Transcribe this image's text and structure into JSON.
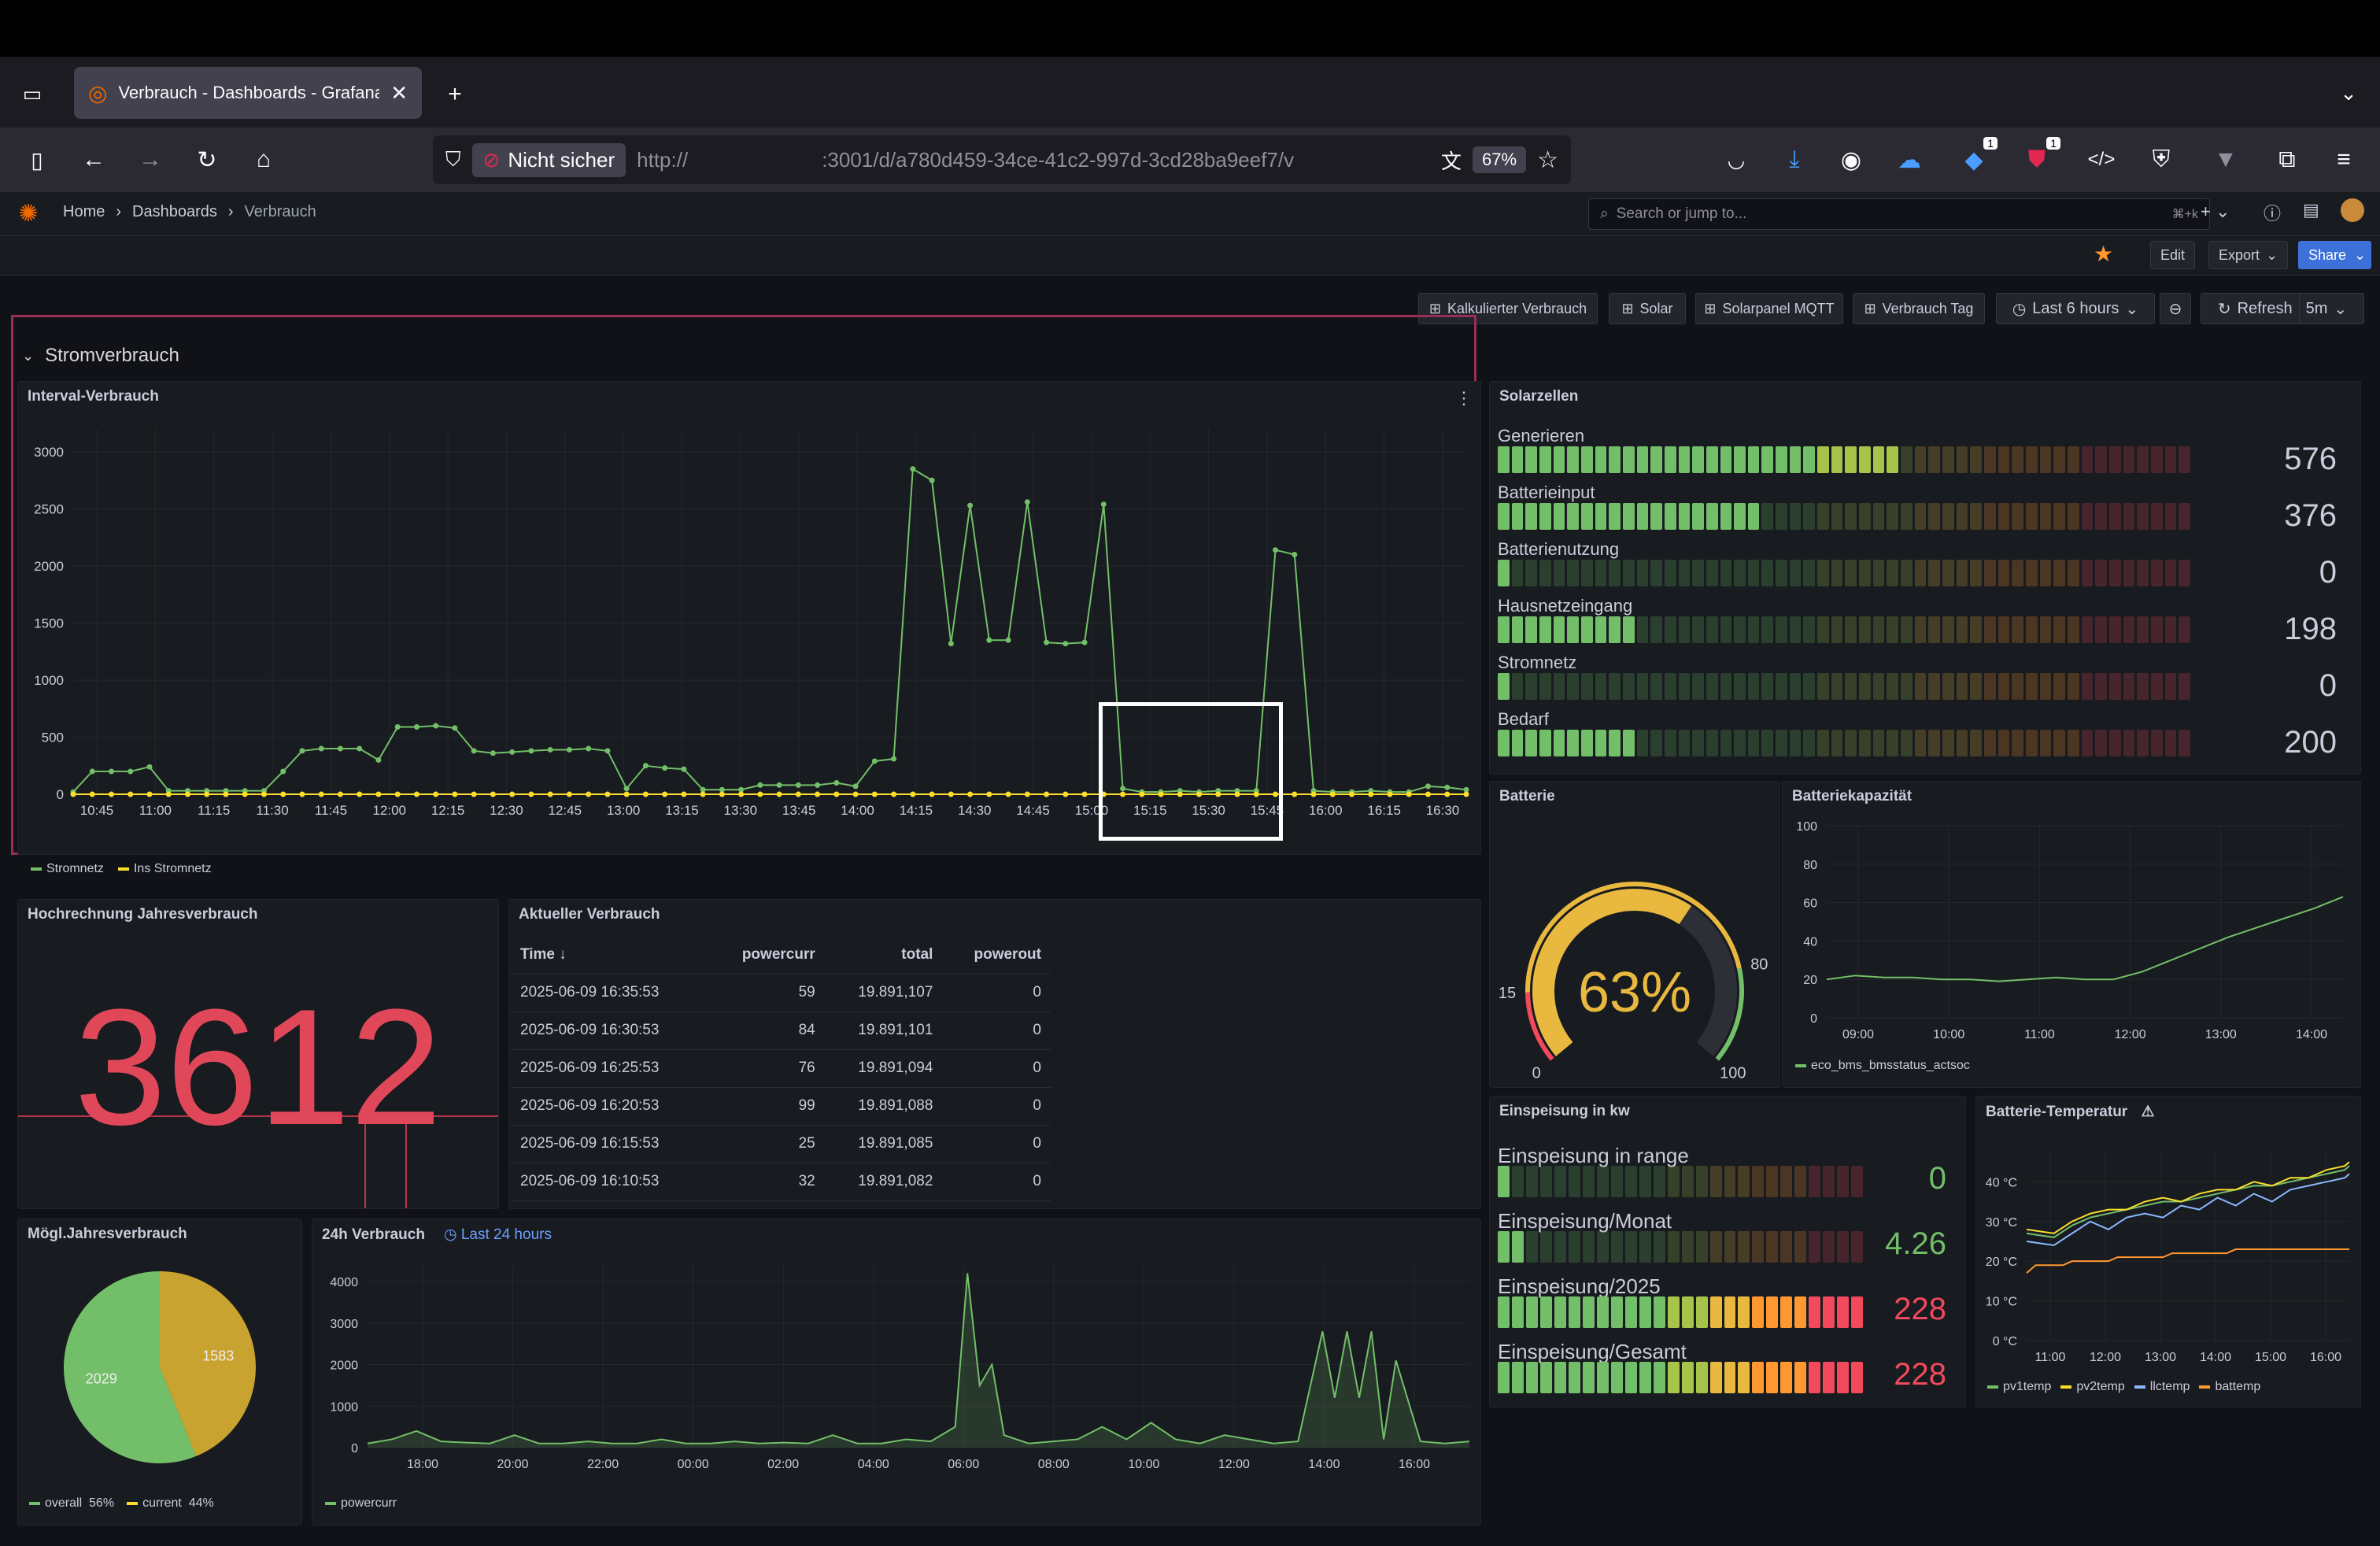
{
  "browser": {
    "tab_title": "Verbrauch - Dashboards - Grafana",
    "security_label": "Nicht sicher",
    "url_scheme": "http://",
    "url_rest": ":3001/d/a780d459-34ce-41c2-997d-3cd28ba9eef7/v",
    "zoom": "67%",
    "badge_1": "1",
    "badge_2": "1"
  },
  "grafana": {
    "breadcrumb": [
      "Home",
      "Dashboards",
      "Verbrauch"
    ],
    "search_placeholder": "Search or jump to...",
    "search_shortcut": "⌘+k",
    "edit_label": "Edit",
    "export_label": "Export",
    "share_label": "Share",
    "links": [
      "Kalkulierter Verbrauch",
      "Solar",
      "Solarpanel MQTT",
      "Verbrauch Tag"
    ],
    "time_range": "Last 6 hours",
    "refresh_label": "Refresh",
    "refresh_interval": "5m",
    "row_title": "Stromverbrauch"
  },
  "panels": {
    "interval": {
      "title": "Interval-Verbrauch",
      "legend": [
        {
          "name": "Stromnetz",
          "color": "#73bf69"
        },
        {
          "name": "Ins Stromnetz",
          "color": "#fade2a"
        }
      ]
    },
    "solarzellen": {
      "title": "Solarzellen",
      "max": 1000,
      "items": [
        {
          "label": "Generieren",
          "value": "576",
          "num": 576
        },
        {
          "label": "Batterieinput",
          "value": "376",
          "num": 376
        },
        {
          "label": "Batterienutzung",
          "value": "0",
          "num": 0
        },
        {
          "label": "Hausnetzeingang",
          "value": "198",
          "num": 198
        },
        {
          "label": "Stromnetz",
          "value": "0",
          "num": 0
        },
        {
          "label": "Bedarf",
          "value": "200",
          "num": 200
        }
      ]
    },
    "batterie": {
      "title": "Batterie",
      "value": "63%",
      "num": 63,
      "ticks": [
        "0",
        "15",
        "80",
        "100"
      ]
    },
    "batteriekapazitaet": {
      "title": "Batteriekapazität",
      "legend": "eco_bms_bmsstatus_actsoc"
    },
    "hochrechnung": {
      "title": "Hochrechnung Jahresverbrauch",
      "value": "3612"
    },
    "aktuell": {
      "title": "Aktueller Verbrauch",
      "columns": [
        "Time",
        "powercurr",
        "total",
        "powerout"
      ],
      "rows": [
        [
          "2025-06-09 16:35:53",
          "59",
          "19.891,107",
          "0"
        ],
        [
          "2025-06-09 16:30:53",
          "84",
          "19.891,101",
          "0"
        ],
        [
          "2025-06-09 16:25:53",
          "76",
          "19.891,094",
          "0"
        ],
        [
          "2025-06-09 16:20:53",
          "99",
          "19.891,088",
          "0"
        ],
        [
          "2025-06-09 16:15:53",
          "25",
          "19.891,085",
          "0"
        ],
        [
          "2025-06-09 16:10:53",
          "32",
          "19.891,082",
          "0"
        ]
      ]
    },
    "einspeisung": {
      "title": "Einspeisung in kw",
      "items": [
        {
          "label": "Einspeisung in range",
          "value": "0",
          "num": 0,
          "color": "#73bf69"
        },
        {
          "label": "Einspeisung/Monat",
          "value": "4.26",
          "num": 0.08,
          "color": "#73bf69"
        },
        {
          "label": "Einspeisung/2025",
          "value": "228",
          "num": 1,
          "color": "#f2495c"
        },
        {
          "label": "Einspeisung/Gesamt",
          "value": "228",
          "num": 1,
          "color": "#f2495c"
        }
      ]
    },
    "temperatur": {
      "title": "Batterie-Temperatur",
      "legend": [
        {
          "name": "pv1temp",
          "color": "#73bf69"
        },
        {
          "name": "pv2temp",
          "color": "#fade2a"
        },
        {
          "name": "llctemp",
          "color": "#8ab8ff"
        },
        {
          "name": "battemp",
          "color": "#ff9830"
        }
      ]
    },
    "moegl": {
      "title": "Mögl.Jahresverbrauch",
      "legend": [
        {
          "name": "overall",
          "pct": "56%",
          "color": "#73bf69"
        },
        {
          "name": "current",
          "pct": "44%",
          "color": "#fade2a"
        }
      ]
    },
    "h24": {
      "title": "24h Verbrauch",
      "timeshift": "Last 24 hours",
      "legend": "powercurr"
    }
  },
  "chart_data": [
    {
      "id": "interval",
      "type": "line",
      "ylim": [
        0,
        3200
      ],
      "yticks": [
        0,
        500,
        1000,
        1500,
        2000,
        2500,
        3000
      ],
      "xticks": [
        "10:45",
        "11:00",
        "11:15",
        "11:30",
        "11:45",
        "12:00",
        "12:15",
        "12:30",
        "12:45",
        "13:00",
        "13:15",
        "13:30",
        "13:45",
        "14:00",
        "14:15",
        "14:30",
        "14:45",
        "15:00",
        "15:15",
        "15:30",
        "15:45",
        "16:00",
        "16:15",
        "16:30"
      ],
      "xrange": [
        640,
        1005
      ],
      "series": [
        {
          "name": "Stromnetz",
          "color": "#73bf69",
          "x": [
            640,
            645,
            650,
            655,
            660,
            665,
            670,
            675,
            680,
            685,
            690,
            695,
            700,
            705,
            710,
            715,
            720,
            725,
            730,
            735,
            740,
            745,
            750,
            755,
            760,
            765,
            770,
            775,
            780,
            785,
            790,
            795,
            800,
            805,
            810,
            815,
            820,
            825,
            830,
            835,
            840,
            845,
            850,
            855,
            860,
            865,
            870,
            875,
            880,
            885,
            890,
            895,
            900,
            905,
            910,
            915,
            920,
            925,
            930,
            935,
            940,
            945,
            950,
            955,
            960,
            965,
            970,
            975,
            980,
            985,
            990,
            995,
            1000,
            1005
          ],
          "values": [
            20,
            200,
            200,
            200,
            240,
            30,
            30,
            30,
            30,
            30,
            30,
            200,
            380,
            400,
            400,
            400,
            300,
            590,
            590,
            600,
            580,
            380,
            360,
            370,
            380,
            390,
            390,
            400,
            380,
            50,
            250,
            230,
            220,
            40,
            40,
            40,
            80,
            80,
            80,
            80,
            100,
            70,
            290,
            310,
            2850,
            2750,
            1320,
            2530,
            1350,
            1350,
            2560,
            1330,
            1320,
            1330,
            2540,
            50,
            20,
            20,
            30,
            20,
            30,
            30,
            30,
            2140,
            2100,
            30,
            20,
            20,
            30,
            20,
            20,
            70,
            60,
            40
          ]
        },
        {
          "name": "Ins Stromnetz",
          "color": "#fade2a",
          "x": [
            640,
            645,
            650,
            655,
            660,
            665,
            670,
            675,
            680,
            685,
            690,
            695,
            700,
            705,
            710,
            715,
            720,
            725,
            730,
            735,
            740,
            745,
            750,
            755,
            760,
            765,
            770,
            775,
            780,
            785,
            790,
            795,
            800,
            805,
            810,
            815,
            820,
            825,
            830,
            835,
            840,
            845,
            850,
            855,
            860,
            865,
            870,
            875,
            880,
            885,
            890,
            895,
            900,
            905,
            910,
            915,
            920,
            925,
            930,
            935,
            940,
            945,
            950,
            955,
            960,
            965,
            970,
            975,
            980,
            985,
            990,
            995,
            1000,
            1005
          ],
          "values": [
            0,
            0,
            0,
            0,
            0,
            0,
            0,
            0,
            0,
            0,
            0,
            0,
            0,
            0,
            0,
            0,
            0,
            0,
            0,
            0,
            0,
            0,
            0,
            0,
            0,
            0,
            0,
            0,
            0,
            0,
            0,
            0,
            0,
            0,
            0,
            0,
            0,
            0,
            0,
            0,
            0,
            0,
            0,
            0,
            0,
            0,
            0,
            0,
            0,
            0,
            0,
            0,
            0,
            0,
            0,
            0,
            0,
            0,
            0,
            0,
            0,
            0,
            0,
            0,
            0,
            0,
            0,
            0,
            0,
            0,
            0,
            0,
            0,
            0
          ]
        }
      ]
    },
    {
      "id": "kapazitaet",
      "type": "line",
      "ylim": [
        0,
        100
      ],
      "yticks": [
        0,
        20,
        40,
        60,
        80,
        100
      ],
      "xticks": [
        "09:00",
        "10:00",
        "11:00",
        "12:00",
        "13:00",
        "14:00"
      ],
      "xrange": [
        520,
        880
      ],
      "series": [
        {
          "name": "eco_bms_bmsstatus_actsoc",
          "color": "#73bf69",
          "x": [
            520,
            540,
            560,
            580,
            600,
            620,
            640,
            660,
            680,
            700,
            720,
            740,
            760,
            780,
            800,
            820,
            840,
            860,
            880
          ],
          "values": [
            20,
            22,
            21,
            21,
            20,
            20,
            19,
            20,
            21,
            20,
            20,
            24,
            30,
            36,
            42,
            47,
            52,
            57,
            63
          ]
        }
      ]
    },
    {
      "id": "temperatur",
      "type": "line",
      "ylim": [
        0,
        48
      ],
      "yticks": [
        0,
        10,
        20,
        30,
        40
      ],
      "ytick_labels": [
        "0 °C",
        "10 °C",
        "20 °C",
        "30 °C",
        "40 °C"
      ],
      "xticks": [
        "11:00",
        "12:00",
        "13:00",
        "14:00",
        "15:00",
        "16:00"
      ],
      "xrange": [
        650,
        1005
      ],
      "series": [
        {
          "name": "pv1temp",
          "color": "#73bf69",
          "x": [
            650,
            680,
            700,
            720,
            740,
            760,
            780,
            800,
            820,
            840,
            860,
            880,
            900,
            920,
            940,
            960,
            980,
            1000,
            1005
          ],
          "values": [
            27,
            26,
            29,
            31,
            32,
            33,
            34,
            35,
            35,
            36,
            37,
            38,
            39,
            39,
            40,
            41,
            42,
            43,
            44
          ]
        },
        {
          "name": "pv2temp",
          "color": "#fade2a",
          "x": [
            650,
            680,
            700,
            720,
            740,
            760,
            780,
            800,
            820,
            840,
            860,
            880,
            900,
            920,
            940,
            960,
            980,
            1000,
            1005
          ],
          "values": [
            28,
            27,
            30,
            32,
            33,
            33,
            35,
            36,
            35,
            37,
            38,
            38,
            40,
            39,
            41,
            41,
            43,
            44,
            45
          ]
        },
        {
          "name": "llctemp",
          "color": "#8ab8ff",
          "x": [
            650,
            680,
            700,
            720,
            740,
            760,
            780,
            800,
            820,
            840,
            860,
            880,
            900,
            920,
            940,
            960,
            980,
            1000,
            1005
          ],
          "values": [
            25,
            24,
            27,
            30,
            28,
            31,
            32,
            31,
            34,
            33,
            36,
            34,
            37,
            35,
            38,
            39,
            40,
            41,
            42
          ]
        },
        {
          "name": "battemp",
          "color": "#ff9830",
          "x": [
            650,
            660,
            690,
            700,
            740,
            750,
            800,
            810,
            870,
            880,
            1005
          ],
          "values": [
            17,
            19,
            19,
            20,
            20,
            21,
            21,
            22,
            22,
            23,
            23
          ]
        }
      ]
    },
    {
      "id": "pie",
      "type": "pie",
      "categories": [
        "overall",
        "current"
      ],
      "values": [
        2029,
        1583
      ],
      "colors": [
        "#73bf69",
        "#c9a330"
      ]
    },
    {
      "id": "h24",
      "type": "line",
      "ylim": [
        0,
        4400
      ],
      "yticks": [
        0,
        1000,
        2000,
        3000,
        4000
      ],
      "xticks": [
        "18:00",
        "20:00",
        "22:00",
        "00:00",
        "02:00",
        "04:00",
        "06:00",
        "08:00",
        "10:00",
        "12:00",
        "14:00",
        "16:00"
      ],
      "xrange": [
        1050,
        1500
      ],
      "series": [
        {
          "name": "powercurr",
          "color": "#73bf69",
          "x": [
            1050,
            1060,
            1070,
            1080,
            1090,
            1100,
            1110,
            1120,
            1130,
            1140,
            1150,
            1160,
            1170,
            1180,
            1190,
            1200,
            1210,
            1220,
            1230,
            1240,
            1250,
            1260,
            1270,
            1280,
            1290,
            1295,
            1300,
            1305,
            1310,
            1320,
            1330,
            1340,
            1350,
            1360,
            1370,
            1380,
            1390,
            1400,
            1410,
            1420,
            1430,
            1440,
            1445,
            1450,
            1455,
            1460,
            1465,
            1470,
            1480,
            1490,
            1500
          ],
          "values": [
            100,
            200,
            400,
            150,
            120,
            100,
            300,
            100,
            100,
            150,
            100,
            100,
            200,
            100,
            100,
            150,
            100,
            120,
            100,
            300,
            100,
            100,
            200,
            150,
            500,
            4200,
            1500,
            2000,
            300,
            100,
            150,
            200,
            500,
            200,
            600,
            200,
            100,
            300,
            200,
            100,
            150,
            2800,
            1200,
            2800,
            1200,
            2800,
            200,
            2100,
            150,
            100,
            150
          ]
        }
      ]
    }
  ]
}
